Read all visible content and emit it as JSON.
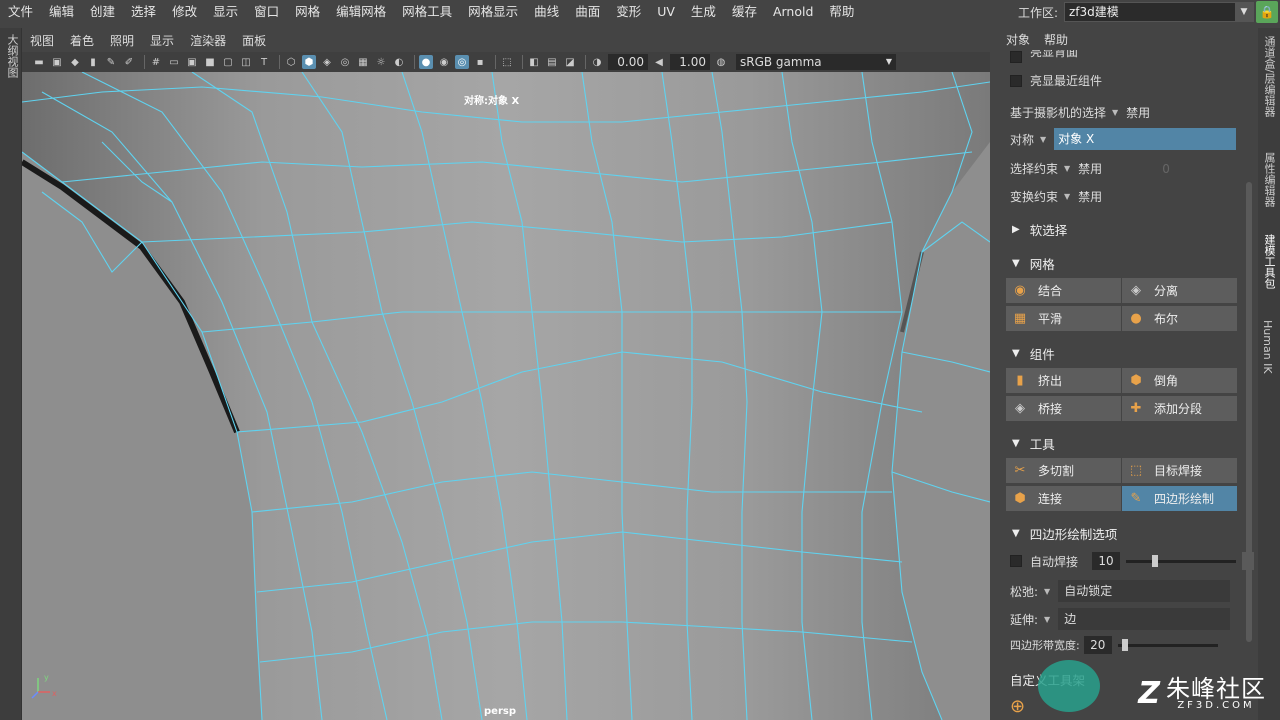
{
  "menubar": {
    "items": [
      "文件",
      "编辑",
      "创建",
      "选择",
      "修改",
      "显示",
      "窗口",
      "网格",
      "编辑网格",
      "网格工具",
      "网格显示",
      "曲线",
      "曲面",
      "变形",
      "UV",
      "生成",
      "缓存",
      "Arnold",
      "帮助"
    ]
  },
  "workspace": {
    "label": "工作区:",
    "value": "zf3d建模"
  },
  "left_tab": {
    "label": "大纲视图"
  },
  "viewport_menu": {
    "items": [
      "视图",
      "着色",
      "照明",
      "显示",
      "渲染器",
      "面板"
    ]
  },
  "viewport_toolbar": {
    "exposure": "0.00",
    "gamma": "1.00",
    "color_space": "sRGB gamma"
  },
  "viewport": {
    "symmetry_label": "对称:对象 X",
    "camera_label": "persp",
    "axis_x": "x",
    "axis_y": "y"
  },
  "right_panel": {
    "menu": [
      "对象",
      "帮助"
    ],
    "opt_backface": "亮显背面",
    "opt_recent": "亮显最近组件",
    "camera_select": {
      "label": "基于摄影机的选择",
      "value": "禁用"
    },
    "symmetry": {
      "label": "对称",
      "value": "对象 X"
    },
    "select_constraint": {
      "label": "选择约束",
      "value": "禁用",
      "num": "0"
    },
    "transform_constraint": {
      "label": "变换约束",
      "value": "禁用"
    },
    "soft_select": "软选择",
    "sections": {
      "mesh": {
        "title": "网格",
        "buttons": [
          "结合",
          "分离",
          "平滑",
          "布尔"
        ]
      },
      "components": {
        "title": "组件",
        "buttons": [
          "挤出",
          "倒角",
          "桥接",
          "添加分段"
        ]
      },
      "tools": {
        "title": "工具",
        "buttons": [
          "多切割",
          "目标焊接",
          "连接",
          "四边形绘制"
        ]
      }
    },
    "quad_options": {
      "title": "四边形绘制选项",
      "auto_weld": "自动焊接",
      "auto_weld_value": "10",
      "help": "?",
      "relax_label": "松弛:",
      "relax_value": "自动锁定",
      "extend_label": "延伸:",
      "extend_value": "边",
      "strip_label": "四边形带宽度:",
      "strip_value": "20",
      "strip_fraction": 0.05,
      "weld_fraction": 0.25
    },
    "shelf_title": "自定义工具架"
  },
  "right_tabs": [
    "通道盒/层编辑器",
    "属性编辑器",
    "建模工具包",
    "Human IK"
  ],
  "watermark": {
    "logo": "Z",
    "cn": "朱峰社区",
    "en": "ZF3D.COM"
  },
  "colors": {
    "accent": "#5285a6",
    "wire": "#5fd3f0",
    "lock": "#5aa55a",
    "icon_orange": "#e8a24a"
  }
}
